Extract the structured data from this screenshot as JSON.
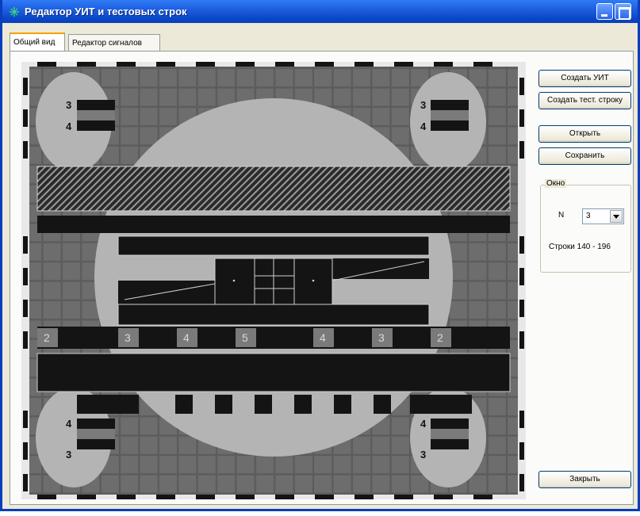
{
  "window": {
    "title": "Редактор УИТ и тестовых строк",
    "accent_color": "#0a47c8"
  },
  "tabs": [
    {
      "label": "Общий вид",
      "active": true
    },
    {
      "label": "Редактор сигналов",
      "active": false
    }
  ],
  "pattern": {
    "top_left_numbers": [
      "3",
      "4"
    ],
    "top_right_numbers": [
      "3",
      "4"
    ],
    "bottom_left_numbers": [
      "4",
      "3"
    ],
    "bottom_right_numbers": [
      "4",
      "3"
    ],
    "scale_labels": [
      "2",
      "3",
      "4",
      "5",
      "4",
      "3",
      "2"
    ]
  },
  "buttons": {
    "create_uit": "Создать УИТ",
    "create_test_line": "Создать тест. строку",
    "open": "Открыть",
    "save": "Сохранить",
    "close": "Закрыть"
  },
  "window_group": {
    "title": "Окно",
    "n_label": "N",
    "n_value": "3",
    "rows_text": "Строки 140 - 196"
  }
}
